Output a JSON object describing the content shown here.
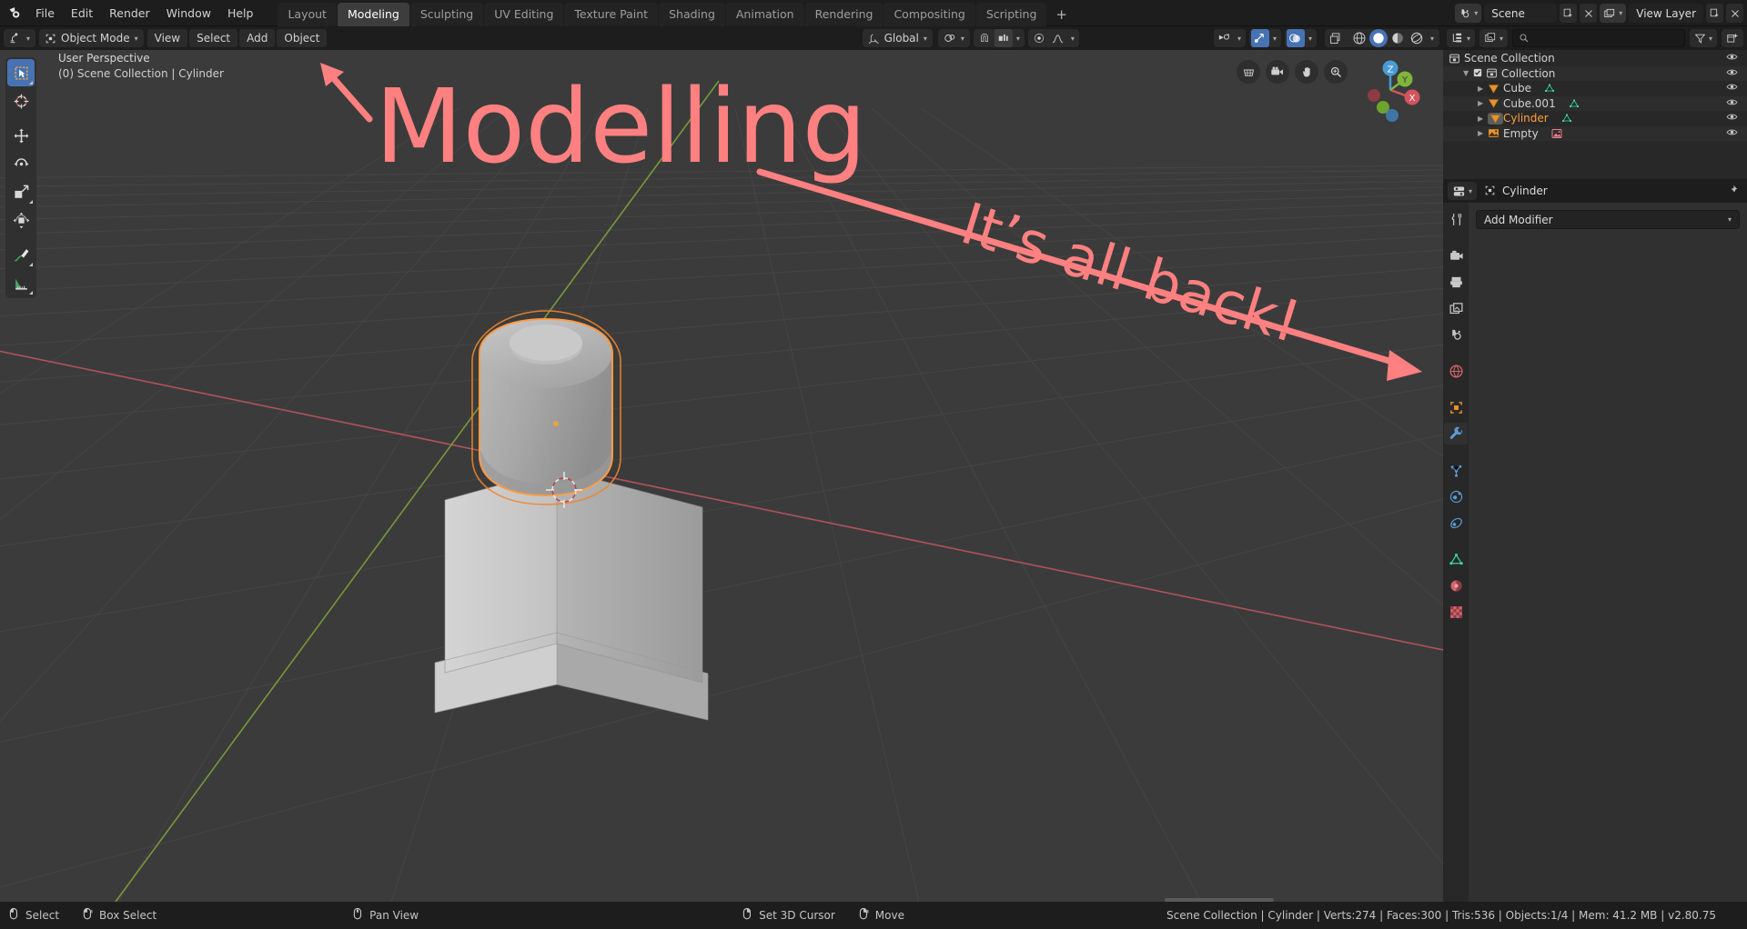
{
  "app": {
    "name": "Blender",
    "version_label": "v2.80.75"
  },
  "topbar": {
    "menus": [
      "File",
      "Edit",
      "Render",
      "Window",
      "Help"
    ],
    "workspace_tabs": [
      {
        "label": "Layout",
        "active": false
      },
      {
        "label": "Modeling",
        "active": true
      },
      {
        "label": "Sculpting",
        "active": false
      },
      {
        "label": "UV Editing",
        "active": false
      },
      {
        "label": "Texture Paint",
        "active": false
      },
      {
        "label": "Shading",
        "active": false
      },
      {
        "label": "Animation",
        "active": false
      },
      {
        "label": "Rendering",
        "active": false
      },
      {
        "label": "Compositing",
        "active": false
      },
      {
        "label": "Scripting",
        "active": false
      }
    ],
    "add_workspace_label": "+",
    "scene_name": "Scene",
    "view_layer_name": "View Layer",
    "scene_icon": "scene-data-icon",
    "viewlayer_icon": "view-layer-icon",
    "new_scene_icon": "new-scene-icon",
    "unlink_scene_icon": "unlink-scene-icon",
    "new_viewlayer_icon": "new-view-layer-icon",
    "remove_viewlayer_icon": "remove-view-layer-icon"
  },
  "viewport": {
    "header": {
      "editor_type_icon": "editor-type-3d-viewport-icon",
      "mode_label": "Object Mode",
      "mode_icon": "object-mode-icon",
      "menus": [
        "View",
        "Select",
        "Add",
        "Object"
      ],
      "transform_orientation": "Global",
      "transform_orientation_icon": "orientation-global-icon",
      "pivot_icon": "pivot-point-icon",
      "snap_magnet_icon": "snap-magnet-icon",
      "snap_target_icon": "snap-increment-icon",
      "proportional_edit_icon": "proportional-editing-icon",
      "falloff_icon": "proportional-falloff-smooth-icon",
      "show_gizmo_icon": "show-gizmo-icon",
      "overlays_icon": "show-overlays-icon",
      "xray_icon": "toggle-xray-icon",
      "shading_modes": [
        {
          "name": "wireframe-shading",
          "active": false
        },
        {
          "name": "solid-shading",
          "active": true
        },
        {
          "name": "material-preview-shading",
          "active": false
        },
        {
          "name": "rendered-shading",
          "active": false
        }
      ]
    },
    "info_line1": "User Perspective",
    "info_line2": "(0) Scene Collection | Cylinder",
    "tools": [
      {
        "name": "tweak-select-box",
        "label": "Select Box",
        "active": true
      },
      {
        "name": "cursor-tool",
        "label": "Cursor",
        "active": false
      },
      {
        "name": "move-tool",
        "label": "Move",
        "active": false
      },
      {
        "name": "rotate-tool",
        "label": "Rotate",
        "active": false
      },
      {
        "name": "scale-tool",
        "label": "Scale",
        "active": false
      },
      {
        "name": "transform-tool",
        "label": "Transform",
        "active": false
      },
      {
        "name": "annotate-tool",
        "label": "Annotate",
        "active": false
      },
      {
        "name": "measure-tool",
        "label": "Measure",
        "active": false
      }
    ],
    "nav_buttons": [
      {
        "name": "toggle-orthographic-button",
        "label": "Toggle Orthographic"
      },
      {
        "name": "camera-view-button",
        "label": "Camera View"
      },
      {
        "name": "pan-view-button",
        "label": "Pan View"
      },
      {
        "name": "zoom-view-button",
        "label": "Zoom View"
      }
    ],
    "gizmo_axes": [
      "Z",
      "Y",
      "X"
    ]
  },
  "annotations": [
    {
      "name": "annotation-modelling",
      "text": "Modelling",
      "color": "#ff8080"
    },
    {
      "name": "annotation-its-all-back",
      "text": "It’s all back!",
      "color": "#ff8080"
    }
  ],
  "outliner": {
    "header": {
      "display_mode_icon": "outliner-display-mode-icon",
      "filter_id_icon": "filter-id-type-icon",
      "search_placeholder": "",
      "search_value": "",
      "search_icon": "search-icon",
      "filter_icon": "filter-funnel-icon",
      "new_collection_icon": "new-collection-icon"
    },
    "rows": [
      {
        "label": "Scene Collection",
        "icon": "collection-icon",
        "depth": 0,
        "selected": false,
        "expanded": false,
        "has_checkbox": false,
        "has_disclosure": false,
        "data_icon": null,
        "eye": true
      },
      {
        "label": "Collection",
        "icon": "collection-icon",
        "depth": 1,
        "selected": false,
        "expanded": true,
        "has_checkbox": true,
        "has_disclosure": true,
        "data_icon": null,
        "eye": true
      },
      {
        "label": "Cube",
        "icon": "object-mesh-icon",
        "depth": 2,
        "selected": false,
        "expanded": false,
        "has_checkbox": false,
        "has_disclosure": true,
        "data_icon": "mesh-data-icon",
        "eye": true
      },
      {
        "label": "Cube.001",
        "icon": "object-mesh-icon",
        "depth": 2,
        "selected": false,
        "expanded": false,
        "has_checkbox": false,
        "has_disclosure": true,
        "data_icon": "mesh-data-icon",
        "eye": true
      },
      {
        "label": "Cylinder",
        "icon": "object-mesh-icon",
        "depth": 2,
        "selected": true,
        "expanded": false,
        "has_checkbox": false,
        "has_disclosure": true,
        "data_icon": "mesh-data-icon",
        "eye": true
      },
      {
        "label": "Empty",
        "icon": "object-empty-image-icon",
        "depth": 2,
        "selected": false,
        "expanded": false,
        "has_checkbox": false,
        "has_disclosure": true,
        "data_icon": "image-data-icon",
        "eye": true
      }
    ]
  },
  "properties": {
    "header": {
      "editor_type_icon": "editor-type-properties-icon",
      "breadcrumb_icon": "object-icon",
      "breadcrumb_label": "Cylinder",
      "pin_icon": "pin-icon"
    },
    "tabs": [
      {
        "name": "tool-tab",
        "active": false
      },
      {
        "name": "render-tab",
        "active": false
      },
      {
        "name": "output-tab",
        "active": false
      },
      {
        "name": "view-layer-tab",
        "active": false
      },
      {
        "name": "scene-tab",
        "active": false
      },
      {
        "name": "world-tab",
        "active": false
      },
      {
        "name": "object-tab",
        "active": false
      },
      {
        "name": "modifier-tab",
        "active": true
      },
      {
        "name": "particles-tab",
        "active": false
      },
      {
        "name": "physics-tab",
        "active": false
      },
      {
        "name": "constraints-tab",
        "active": false
      },
      {
        "name": "object-data-tab",
        "active": false
      },
      {
        "name": "material-tab",
        "active": false
      },
      {
        "name": "texture-tab",
        "active": false
      }
    ],
    "add_modifier_label": "Add Modifier",
    "add_modifier_caret_icon": "chevron-down-icon"
  },
  "statusbar": {
    "keymap": [
      {
        "label": "Select",
        "icon": "mouse-left-icon"
      },
      {
        "label": "Box Select",
        "icon": "mouse-left-drag-icon"
      },
      {
        "label": "Pan View",
        "icon": "mouse-middle-icon"
      },
      {
        "label": "Set 3D Cursor",
        "icon": "mouse-right-icon"
      },
      {
        "label": "Move",
        "icon": "mouse-right-drag-icon"
      }
    ],
    "stats": "Scene Collection | Cylinder | Verts:274 | Faces:300 | Tris:536 | Objects:1/4 | Mem: 41.2 MB | v2.80.75"
  },
  "colors": {
    "accent_blue": "#4772b3",
    "selected_orange": "#ffa13c",
    "annotation_pink": "#ff8080",
    "viewport_bg": "#3b3b3b",
    "header_bg": "#1d1d1d",
    "panel_bg": "#303030",
    "outliner_bg": "#282828"
  }
}
